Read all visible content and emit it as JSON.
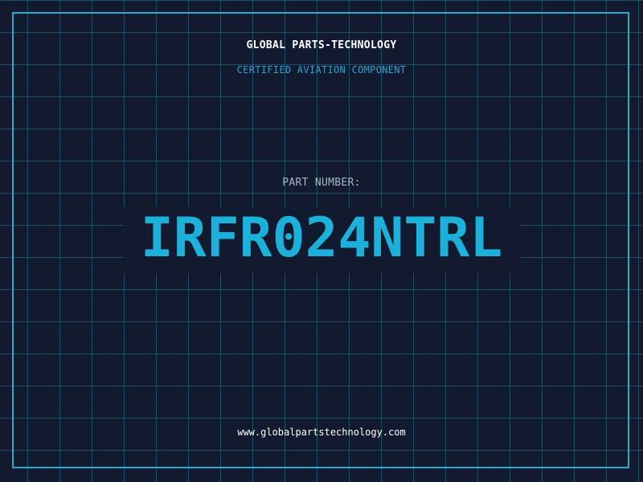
{
  "header": {
    "company": "GLOBAL PARTS-TECHNOLOGY",
    "subtitle": "CERTIFIED AVIATION COMPONENT"
  },
  "part": {
    "label": "PART NUMBER:",
    "number": "IRFR024NTRL"
  },
  "footer": {
    "website": "www.globalpartstechnology.com"
  },
  "colors": {
    "background": "#111a2f",
    "grid": "#28788f",
    "accent": "#1cb1da",
    "frame": "#2aa8d0"
  }
}
